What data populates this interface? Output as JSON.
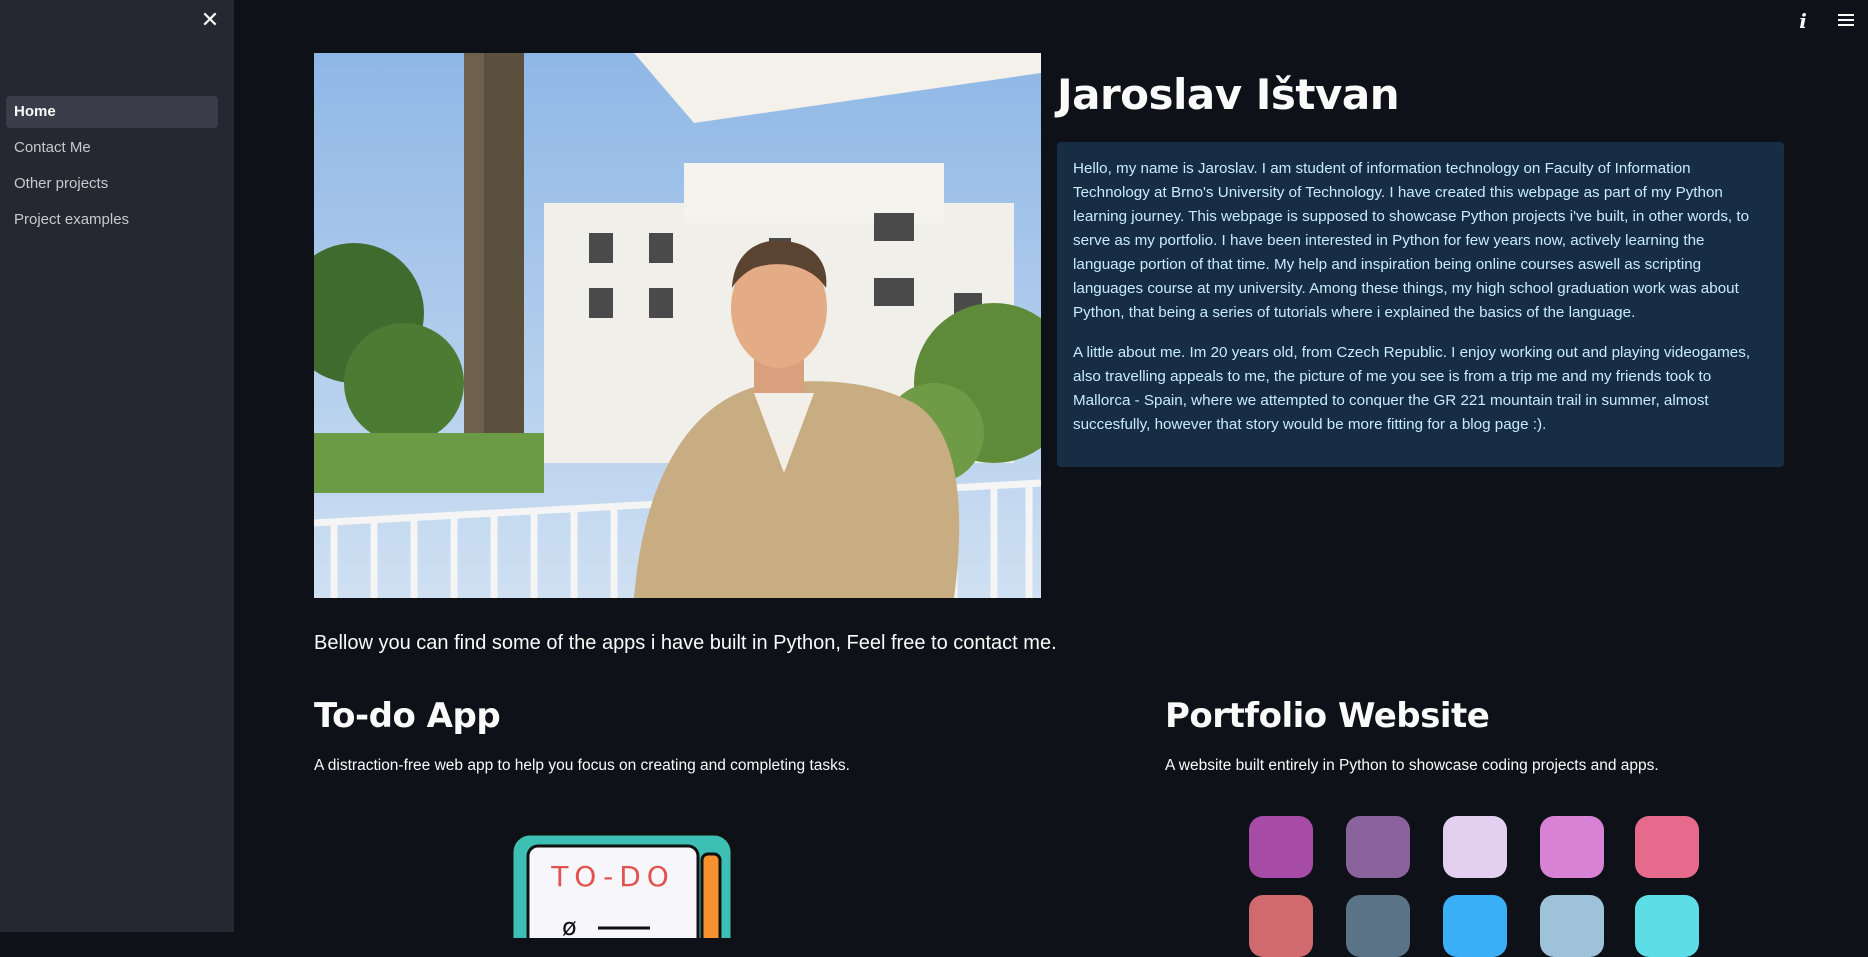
{
  "sidebar": {
    "close_icon": "close-icon",
    "items": [
      {
        "label": "Home",
        "active": true
      },
      {
        "label": "Contact Me",
        "active": false
      },
      {
        "label": "Other projects",
        "active": false
      },
      {
        "label": "Project examples",
        "active": false
      }
    ]
  },
  "topbar": {
    "info_icon": "info-icon",
    "menu_icon": "hamburger-menu-icon"
  },
  "hero": {
    "name": "Jaroslav Ištvan",
    "bio_p1": "Hello, my name is Jaroslav. I am student of information technology on Faculty of Information Technology at Brno's University of Technology. I have created this webpage as part of my Python learning journey. This webpage is supposed to showcase Python projects i've built, in other words, to serve as my portfolio. I have been interested in Python for few years now, actively learning the language portion of that time. My help and inspiration being online courses aswell as scripting languages course at my university. Among these things, my high school graduation work was about Python, that being a series of tutorials where i explained the basics of the language.",
    "bio_p2": "A little about me. Im 20 years old, from Czech Republic. I enjoy working out and playing videogames, also travelling appeals to me, the picture of me you see is from a trip me and my friends took to Mallorca - Spain, where we attempted to conquer the GR 221 mountain trail in summer, almost succesfully, however that story would be more fitting for a blog page :)."
  },
  "intro": "Bellow you can find some of the apps i have built in Python, Feel free to contact me.",
  "projects": [
    {
      "title": "To-do App",
      "description": "A distraction-free web app to help you focus on creating and completing tasks.",
      "image_text": "TO-DO"
    },
    {
      "title": "Portfolio Website",
      "description": "A website built entirely in Python to showcase coding projects and apps."
    }
  ],
  "colors": {
    "background": "#0e1117",
    "sidebar": "#262730",
    "bio_bg": "#172d43",
    "bio_text": "#c7ebff",
    "swatches": [
      "#a64ca6",
      "#8a639d",
      "#e3cff0",
      "#d782d5",
      "#e56a8b",
      "#d16a6e",
      "#5a7386",
      "#3aaff7",
      "#9ec2d9",
      "#5ddde5"
    ]
  }
}
